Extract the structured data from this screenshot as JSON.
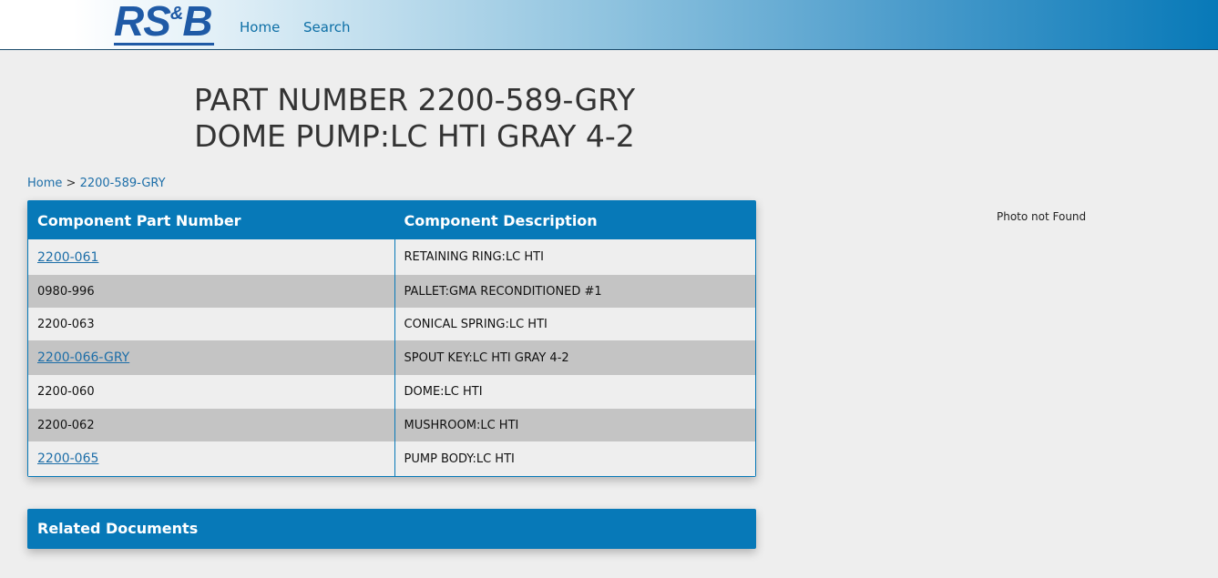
{
  "header": {
    "logo_main": "RS",
    "logo_amp": "&",
    "logo_end": "B",
    "nav": [
      {
        "label": "Home"
      },
      {
        "label": "Search"
      }
    ]
  },
  "title": {
    "line1": "PART NUMBER 2200-589-GRY",
    "line2": "DOME PUMP:LC HTI GRAY 4-2"
  },
  "breadcrumb": {
    "home": "Home",
    "separator": ">",
    "current": "2200-589-GRY"
  },
  "components": {
    "headers": [
      "Component Part Number",
      "Component Description"
    ],
    "rows": [
      {
        "part": "2200-061",
        "desc": "RETAINING RING:LC HTI",
        "link": true
      },
      {
        "part": "0980-996",
        "desc": "PALLET:GMA RECONDITIONED #1",
        "link": false
      },
      {
        "part": "2200-063",
        "desc": "CONICAL SPRING:LC HTI",
        "link": false
      },
      {
        "part": "2200-066-GRY",
        "desc": "SPOUT KEY:LC HTI GRAY 4-2",
        "link": true
      },
      {
        "part": "2200-060",
        "desc": "DOME:LC HTI",
        "link": false
      },
      {
        "part": "2200-062",
        "desc": "MUSHROOM:LC HTI",
        "link": false
      },
      {
        "part": "2200-065",
        "desc": "PUMP BODY:LC HTI",
        "link": true
      }
    ]
  },
  "photo": {
    "text": "Photo not Found"
  },
  "related": {
    "title": "Related Documents"
  },
  "colors": {
    "accent": "#0779b8",
    "link": "#1d6ea8",
    "row_dark": "#c4c4c4",
    "background": "#eeeeee"
  }
}
